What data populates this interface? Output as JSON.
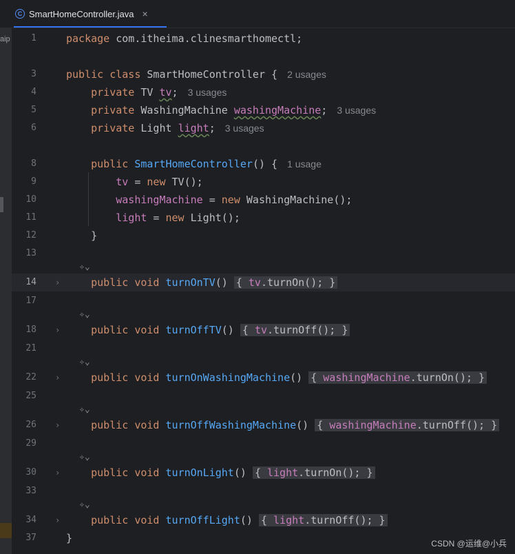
{
  "tab": {
    "file": "SmartHomeController.java",
    "close": "×",
    "icon": "class-icon"
  },
  "side": {
    "fragment": "aip"
  },
  "lines": {
    "l1": {
      "num": "1",
      "pkg_kw": "package",
      "pkg_name": " com.itheima.clinesmarthomectl;"
    },
    "l3": {
      "num": "3",
      "kw": "public class",
      "name": " SmartHomeController {",
      "hint": "2 usages"
    },
    "l4": {
      "num": "4",
      "kw": "private",
      "type": " TV ",
      "field": "tv",
      "end": ";",
      "hint": "3 usages"
    },
    "l5": {
      "num": "5",
      "kw": "private",
      "type": " WashingMachine ",
      "field": "washingMachine",
      "end": ";",
      "hint": "3 usages"
    },
    "l6": {
      "num": "6",
      "kw": "private",
      "type": " Light ",
      "field": "light",
      "end": ";",
      "hint": "3 usages"
    },
    "l8": {
      "num": "8",
      "kw": "public",
      "fn": " SmartHomeController",
      "end": "() {",
      "hint": "1 usage"
    },
    "l9": {
      "num": "9",
      "field": "tv",
      "eq": " = ",
      "kw": "new",
      "rest": " TV();"
    },
    "l10": {
      "num": "10",
      "field": "washingMachine",
      "eq": " = ",
      "kw": "new",
      "rest": " WashingMachine();"
    },
    "l11": {
      "num": "11",
      "field": "light",
      "eq": " = ",
      "kw": "new",
      "rest": " Light();"
    },
    "l12": {
      "num": "12",
      "text": "}"
    },
    "l13": {
      "num": "13"
    },
    "l14": {
      "num": "14",
      "kw": "public void",
      "fn": "turnOnTV",
      "field": "tv",
      "call": ".turnOn();"
    },
    "l17": {
      "num": "17"
    },
    "l18": {
      "num": "18",
      "kw": "public void",
      "fn": "turnOffTV",
      "field": "tv",
      "call": ".turnOff();"
    },
    "l21": {
      "num": "21"
    },
    "l22": {
      "num": "22",
      "kw": "public void",
      "fn": "turnOnWashingMachine",
      "field": "washingMachine",
      "call": ".turnOn();"
    },
    "l25": {
      "num": "25"
    },
    "l26": {
      "num": "26",
      "kw": "public void",
      "fn": "turnOffWashingMachine",
      "field": "washingMachine",
      "call": ".turnOff();"
    },
    "l29": {
      "num": "29"
    },
    "l30": {
      "num": "30",
      "kw": "public void",
      "fn": "turnOnLight",
      "field": "light",
      "call": ".turnOn();"
    },
    "l33": {
      "num": "33"
    },
    "l34": {
      "num": "34",
      "kw": "public void",
      "fn": "turnOffLight",
      "field": "light",
      "call": ".turnOff();"
    },
    "l37": {
      "num": "37",
      "text": "}"
    }
  },
  "ai_icon": "✧⌄",
  "fold_icon": "›",
  "watermark": "CSDN @运维@小兵",
  "colors": {
    "keyword": "#cf8e6d",
    "function": "#56a8f5",
    "field": "#c77dbb",
    "text": "#bcbec4",
    "background": "#1e1f22"
  }
}
